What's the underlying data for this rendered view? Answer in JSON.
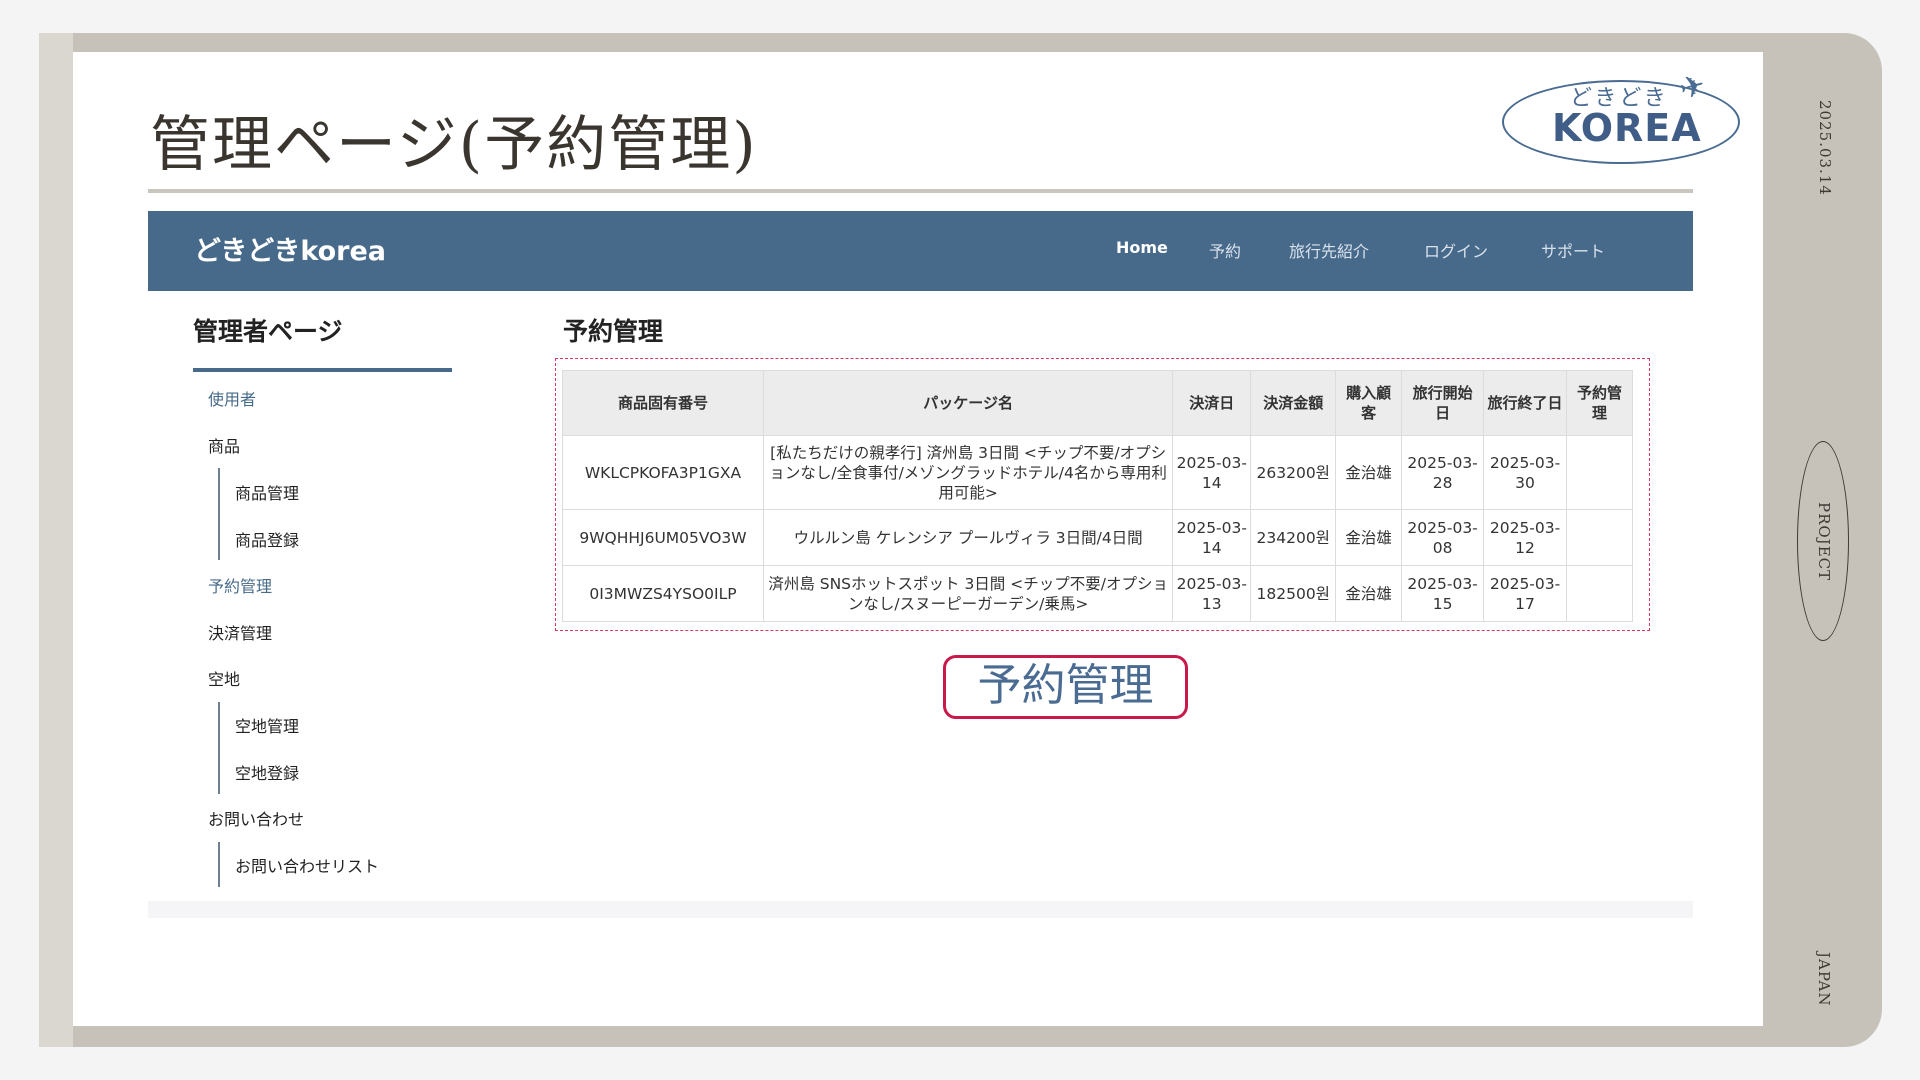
{
  "slide": {
    "title": "管理ページ(予約管理)",
    "side_date": "2025.03.14",
    "side_project": "PROJECT",
    "side_japan": "JAPAN",
    "logo_small": "どきどき",
    "logo_main": "KOREA",
    "logo_icon": "airplane-icon",
    "callout": "予約管理"
  },
  "navbar": {
    "brand": "どきどきkorea",
    "items": [
      "Home",
      "予約",
      "旅行先紹介",
      "ログイン",
      "サポート"
    ]
  },
  "sidebar": {
    "heading": "管理者ページ",
    "items": [
      {
        "label": "使用者",
        "link": true
      },
      {
        "label": "商品"
      },
      {
        "label": "商品管理",
        "sub": true
      },
      {
        "label": "商品登録",
        "sub": true
      },
      {
        "label": "予約管理",
        "link": true
      },
      {
        "label": "決済管理"
      },
      {
        "label": "空地"
      },
      {
        "label": "空地管理",
        "sub": true
      },
      {
        "label": "空地登録",
        "sub": true
      },
      {
        "label": "お問い合わせ"
      },
      {
        "label": "お問い合わせリスト",
        "sub": true
      }
    ]
  },
  "content": {
    "heading": "予約管理",
    "columns": [
      "商品固有番号",
      "パッケージ名",
      "決済日",
      "決済金額",
      "購入顧客",
      "旅行開始日",
      "旅行終了日",
      "予約管理"
    ],
    "rows": [
      [
        "WKLCPKOFA3P1GXA",
        "[私たちだけの親孝行] 済州島 3日間 <チップ不要/オプションなし/全食事付/メゾングラッドホテル/4名から専用利用可能>",
        "2025-03-14",
        "263200원",
        "金治雄",
        "2025-03-28",
        "2025-03-30",
        ""
      ],
      [
        "9WQHHJ6UM05VO3W",
        "ウルルン島 ケレンシア プールヴィラ 3日間/4日間",
        "2025-03-14",
        "234200원",
        "金治雄",
        "2025-03-08",
        "2025-03-12",
        ""
      ],
      [
        "0I3MWZS4YSO0ILP",
        "済州島 SNSホットスポット 3日間 <チップ不要/オプションなし/スヌーピーガーデン/乗馬>",
        "2025-03-13",
        "182500원",
        "金治雄",
        "2025-03-15",
        "2025-03-17",
        ""
      ]
    ]
  }
}
